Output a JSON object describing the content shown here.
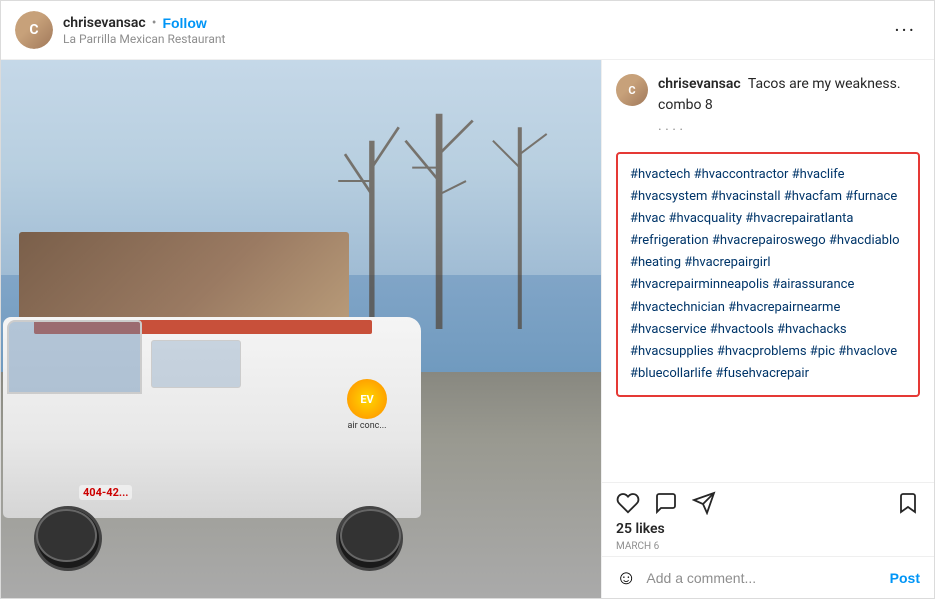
{
  "header": {
    "username": "chrisevansac",
    "dot": "•",
    "follow_label": "Follow",
    "location": "La Parrilla Mexican Restaurant",
    "more_options": "···"
  },
  "caption": {
    "username": "chrisevansac",
    "text": "Tacos are my weakness. combo 8",
    "dots": "·\n·\n·\n·"
  },
  "hashtags": "#hvactech #hvaccontractor #hvaclife #hvacsystem #hvacinstall #hvacfam #furnace #hvac #hvacquality #hvacrepairatlanta #refrigeration #hvacrepairoswego #hvacdiablo #heating #hvacrepairgirl #hvacrepairminneapolis #airassurance #hvactechnician #hvacrepairnearme #hvacservice #hvactools #hvachacks #hvacsupplies #hvacproblems #pic #hvaclove #bluecollarlife #fusehvacrepair",
  "actions": {
    "like_icon": "heart",
    "comment_icon": "comment",
    "share_icon": "share",
    "bookmark_icon": "bookmark"
  },
  "likes": {
    "count": "25",
    "label": "25 likes"
  },
  "date": "MARCH 6",
  "comment_input": {
    "placeholder": "Add a comment...",
    "post_label": "Post"
  }
}
